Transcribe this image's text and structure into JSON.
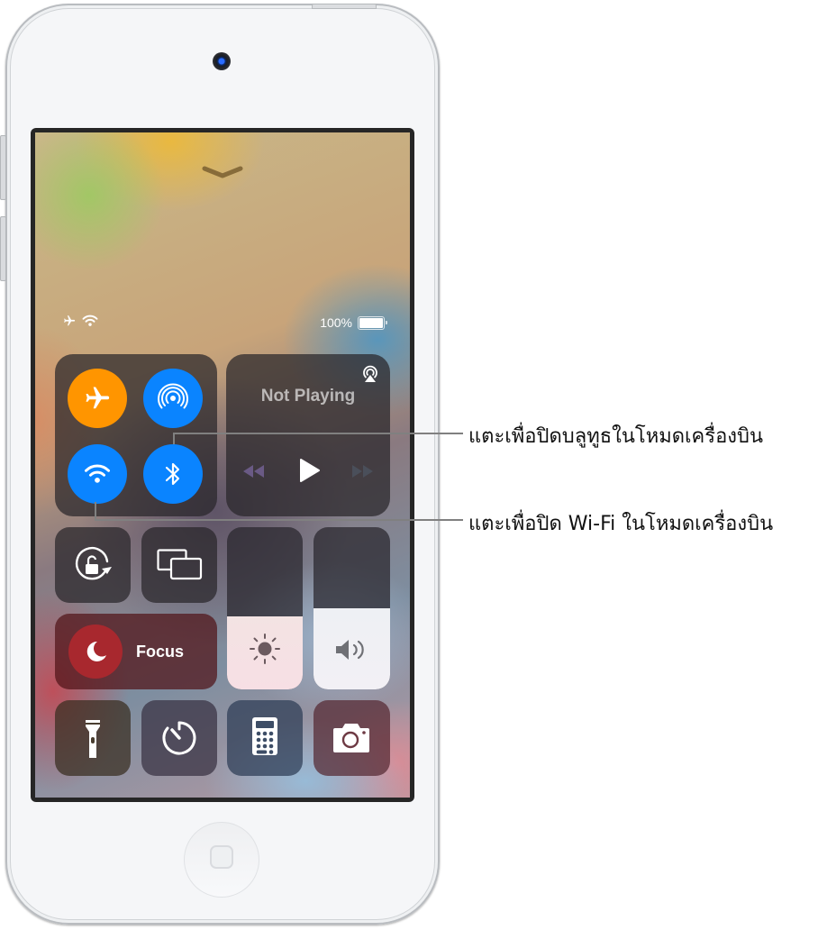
{
  "device": {
    "type": "iPod touch",
    "camera_icon": "front-camera-icon",
    "home_button_icon": "home-button-icon"
  },
  "control_center": {
    "dismiss_icon": "chevron-down-icon",
    "status_bar": {
      "icons": [
        "airplane-icon",
        "wifi-icon"
      ],
      "battery_percent": "100%",
      "battery_level": 1.0,
      "battery_icon": "battery-icon"
    },
    "connectivity": {
      "airplane_mode": {
        "icon": "airplane-icon",
        "state": "on",
        "color": "#FF9500"
      },
      "airdrop": {
        "icon": "airdrop-icon",
        "state": "on",
        "color": "#0A84FF"
      },
      "wifi": {
        "icon": "wifi-icon",
        "state": "on",
        "color": "#0A84FF"
      },
      "bluetooth": {
        "icon": "bluetooth-icon",
        "state": "on",
        "color": "#0A84FF"
      }
    },
    "now_playing": {
      "label": "Not Playing",
      "airplay_icon": "airplay-icon",
      "controls": [
        "rewind-icon",
        "play-icon",
        "fast-forward-icon"
      ]
    },
    "orientation_lock": {
      "icon": "orientation-lock-icon"
    },
    "screen_mirroring": {
      "icon": "screen-mirroring-icon"
    },
    "focus": {
      "label": "Focus",
      "icon": "moon-icon"
    },
    "brightness": {
      "icon": "sun-icon",
      "level": 0.45
    },
    "volume": {
      "icon": "speaker-icon",
      "level": 0.5
    },
    "bottom_row": [
      "flashlight-icon",
      "timer-icon",
      "calculator-icon",
      "camera-icon"
    ]
  },
  "callouts": [
    {
      "text": "แตะเพื่อปิดบลูทูธในโหมดเครื่องบิน",
      "target": "bluetooth"
    },
    {
      "text": "แตะเพื่อปิด Wi-Fi ในโหมดเครื่องบิน",
      "target": "wifi"
    }
  ]
}
